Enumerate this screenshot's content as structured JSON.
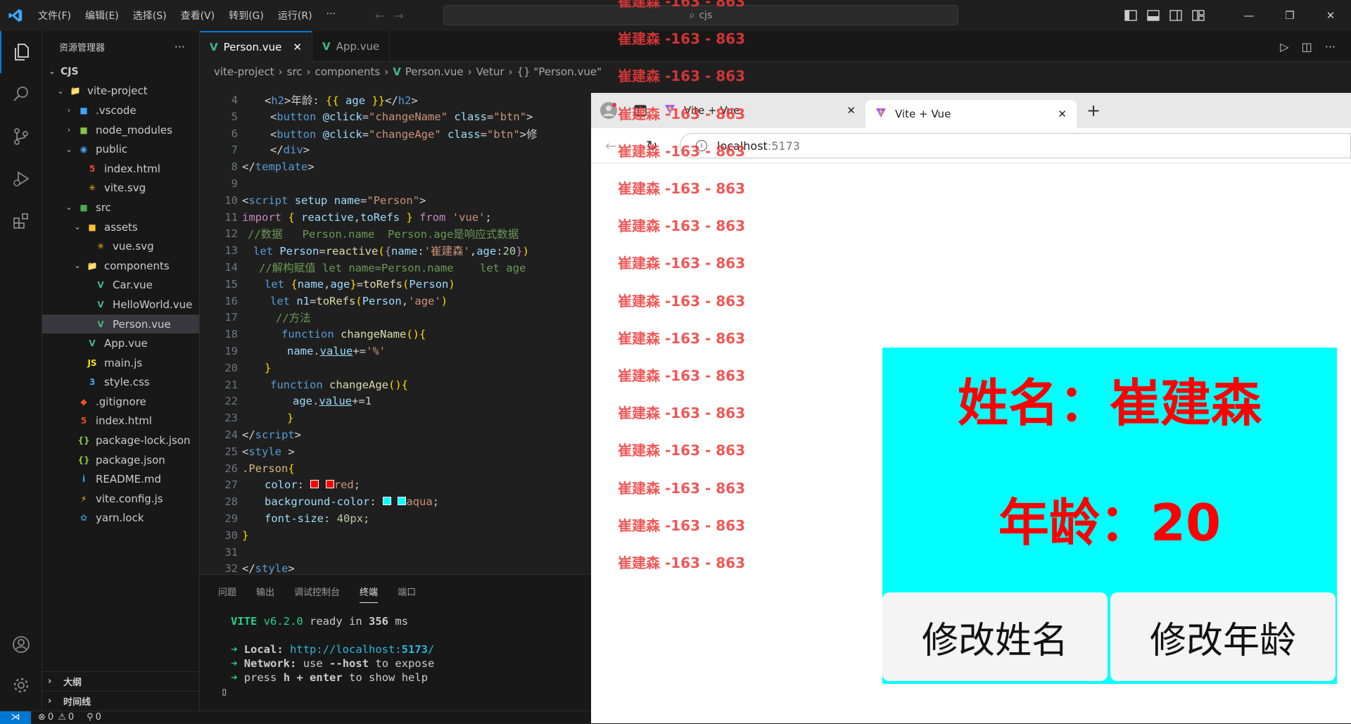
{
  "titlebar": {
    "menu": [
      "文件(F)",
      "编辑(E)",
      "选择(S)",
      "查看(V)",
      "转到(G)",
      "运行(R)",
      "···"
    ],
    "search": "cjs"
  },
  "explorer": {
    "title": "资源管理器",
    "more": "···",
    "root": "CJS",
    "tree": [
      {
        "label": "vite-project",
        "depth": 1,
        "chev": "v",
        "icon": "folder"
      },
      {
        "label": ".vscode",
        "depth": 2,
        "chev": ">",
        "icon": "vscode-folder"
      },
      {
        "label": "node_modules",
        "depth": 2,
        "chev": ">",
        "icon": "node-folder"
      },
      {
        "label": "public",
        "depth": 2,
        "chev": "v",
        "icon": "public-folder"
      },
      {
        "label": "index.html",
        "depth": 3,
        "chev": "",
        "icon": "html"
      },
      {
        "label": "vite.svg",
        "depth": 3,
        "chev": "",
        "icon": "svg"
      },
      {
        "label": "src",
        "depth": 2,
        "chev": "v",
        "icon": "src-folder"
      },
      {
        "label": "assets",
        "depth": 3,
        "chev": "v",
        "icon": "assets-folder"
      },
      {
        "label": "vue.svg",
        "depth": 4,
        "chev": "",
        "icon": "svg"
      },
      {
        "label": "components",
        "depth": 3,
        "chev": "v",
        "icon": "folder"
      },
      {
        "label": "Car.vue",
        "depth": 4,
        "chev": "",
        "icon": "vue"
      },
      {
        "label": "HelloWorld.vue",
        "depth": 4,
        "chev": "",
        "icon": "vue"
      },
      {
        "label": "Person.vue",
        "depth": 4,
        "chev": "",
        "icon": "vue",
        "selected": true
      },
      {
        "label": "App.vue",
        "depth": 3,
        "chev": "",
        "icon": "vue"
      },
      {
        "label": "main.js",
        "depth": 3,
        "chev": "",
        "icon": "js"
      },
      {
        "label": "style.css",
        "depth": 3,
        "chev": "",
        "icon": "css"
      },
      {
        "label": ".gitignore",
        "depth": 2,
        "chev": "",
        "icon": "git"
      },
      {
        "label": "index.html",
        "depth": 2,
        "chev": "",
        "icon": "html"
      },
      {
        "label": "package-lock.json",
        "depth": 2,
        "chev": "",
        "icon": "json"
      },
      {
        "label": "package.json",
        "depth": 2,
        "chev": "",
        "icon": "json"
      },
      {
        "label": "README.md",
        "depth": 2,
        "chev": "",
        "icon": "info"
      },
      {
        "label": "vite.config.js",
        "depth": 2,
        "chev": "",
        "icon": "vite"
      },
      {
        "label": "yarn.lock",
        "depth": 2,
        "chev": "",
        "icon": "yarn"
      }
    ],
    "outline": "大纲",
    "timeline": "时间线"
  },
  "tabs": [
    {
      "label": "Person.vue",
      "active": true
    },
    {
      "label": "App.vue",
      "active": false
    }
  ],
  "breadcrumb": [
    "vite-project",
    "src",
    "components",
    "Person.vue",
    "Vetur",
    "{} \"Person.vue\""
  ],
  "code": [
    {
      "n": "4",
      "html": "<span class='pu'>&lt;</span><span class='tg'>h2</span><span class='pu'>&gt;</span>年龄: <span class='br'>{{</span> <span class='at'>age</span> <span class='br'>}}</span><span class='pu'>&lt;/</span><span class='tg'>h2</span><span class='pu'>&gt;</span>",
      "indent": 92
    },
    {
      "n": "5",
      "html": "<span class='pu'>&lt;</span><span class='tg'>button</span> <span class='at'>@click</span>=<span class='st'>\"changeName\"</span> <span class='at'>class</span>=<span class='st'>\"btn\"</span><span class='pu'>&gt;</span>",
      "indent": 100
    },
    {
      "n": "6",
      "html": "<span class='pu'>&lt;</span><span class='tg'>button</span> <span class='at'>@click</span>=<span class='st'>\"changeAge\"</span> <span class='at'>class</span>=<span class='st'>\"btn\"</span><span class='pu'>&gt;</span>修",
      "indent": 100
    },
    {
      "n": "7",
      "html": "<span class='pu'>&lt;/</span><span class='tg'>div</span><span class='pu'>&gt;</span>",
      "indent": 100
    },
    {
      "n": "8",
      "html": "<span class='pu'>&lt;/</span><span class='tg'>template</span><span class='pu'>&gt;</span>",
      "indent": 60
    },
    {
      "n": "9",
      "html": "",
      "indent": 60
    },
    {
      "n": "10",
      "html": "<span class='pu'>&lt;</span><span class='tg'>script</span> <span class='at'>setup</span> <span class='at'>name</span>=<span class='st'>\"Person\"</span><span class='pu'>&gt;</span>",
      "indent": 60
    },
    {
      "n": "11",
      "html": "<span class='pk'>import</span> <span class='br'>{</span> <span class='at'>reactive</span>,<span class='at'>toRefs</span> <span class='br'>}</span> <span class='pk'>from</span> <span class='st'>'vue'</span>;",
      "indent": 60
    },
    {
      "n": "12",
      "html": "<span class='cm'>//数据   Person.name  Person.age是响应式数据</span>",
      "indent": 68
    },
    {
      "n": "13",
      "html": "<span class='kw'>let</span> <span class='at'>Person</span>=<span class='fn'>reactive</span><span class='br'>(</span><span class='pk'>{</span><span class='at'>name</span>:<span class='st'>'崔建森'</span>,<span class='at'>age</span>:<span class='num'>20</span><span class='pk'>}</span><span class='br'>)</span>",
      "indent": 76
    },
    {
      "n": "14",
      "html": "<span class='cm'>//解构赋值 let name=Person.name    let age</span>",
      "indent": 84
    },
    {
      "n": "15",
      "html": "<span class='kw'>let</span> <span class='br'>{</span><span class='at'>name</span>,<span class='at'>age</span><span class='br'>}</span>=<span class='fn'>toRefs</span><span class='br'>(</span><span class='at'>Person</span><span class='br'>)</span>",
      "indent": 92
    },
    {
      "n": "16",
      "html": "<span class='kw'>let</span> <span class='at'>n1</span>=<span class='fn'>toRefs</span><span class='br'>(</span><span class='at'>Person</span>,<span class='st'>'age'</span><span class='br'>)</span>",
      "indent": 100
    },
    {
      "n": "17",
      "html": "<span class='cm'>//方法</span>",
      "indent": 108
    },
    {
      "n": "18",
      "html": "<span class='kw'>function</span> <span class='fn'>changeName</span><span class='br'>()</span><span class='br'>{</span>",
      "indent": 116
    },
    {
      "n": "19",
      "html": "<span class='at'>name</span>.<span class='at' style='text-decoration:underline'>value</span>+=<span class='st'>'%'</span>",
      "indent": 124
    },
    {
      "n": "20",
      "html": "<span class='br'>}</span>",
      "indent": 92
    },
    {
      "n": "21",
      "html": "<span class='kw'>function</span> <span class='fn'>changeAge</span><span class='br'>()</span><span class='br'>{</span>",
      "indent": 100
    },
    {
      "n": "22",
      "html": "<span class='at'>age</span>.<span class='at' style='text-decoration:underline'>value</span>+=<span class='num'>1</span>",
      "indent": 132
    },
    {
      "n": "23",
      "html": "<span class='br'>}</span>",
      "indent": 124
    },
    {
      "n": "24",
      "html": "<span class='pu'>&lt;/</span><span class='tg'>script</span><span class='pu'>&gt;</span>",
      "indent": 60
    },
    {
      "n": "25",
      "html": "<span class='pu'>&lt;</span><span class='tg'>style</span> <span class='pu'>&gt;</span>",
      "indent": 60
    },
    {
      "n": "26",
      "html": "<span class='sel'>.Person</span><span class='br'>{</span>",
      "indent": 60
    },
    {
      "n": "27",
      "html": "<span class='at'>color</span>: <span style='display:inline-block;width:12px;height:12px;background:#ff0000;border:1px solid #fff'></span> <span style='display:inline-block;width:12px;height:12px;background:#ff0000;border:1px solid #fff'></span><span class='st'>red</span>;",
      "indent": 92
    },
    {
      "n": "28",
      "html": "<span class='at'>background-color</span>: <span style='display:inline-block;width:12px;height:12px;background:#00ffff;border:1px solid #fff'></span> <span style='display:inline-block;width:12px;height:12px;background:#00ffff;border:1px solid #fff'></span><span class='st'>aqua</span>;",
      "indent": 92
    },
    {
      "n": "29",
      "html": "<span class='at'>font-size</span>: <span class='num'>40px</span>;",
      "indent": 92
    },
    {
      "n": "30",
      "html": "<span class='br'>}</span>",
      "indent": 60
    },
    {
      "n": "31",
      "html": "",
      "indent": 60
    },
    {
      "n": "32",
      "html": "<span class='pu'>&lt;/</span><span class='tg'>style</span><span class='pu'>&gt;</span>",
      "indent": 60
    }
  ],
  "panel": {
    "tabs": [
      "问题",
      "输出",
      "调试控制台",
      "终端",
      "端口"
    ],
    "active_tab": "终端",
    "vite_name": "VITE",
    "vite_version": "v6.2.0",
    "ready_text": "ready in",
    "ready_ms": "356",
    "ms": "ms",
    "local_label": "Local:",
    "local_url_a": "http://localhost:",
    "local_url_b": "5173",
    "network_label": "Network:",
    "network_a": "use",
    "network_b": "--host",
    "network_c": "to expose",
    "help_a": "press",
    "help_b": "h + enter",
    "help_c": "to show help",
    "arrow": "➜",
    "cursor": "▯"
  },
  "status": {
    "errors": "0",
    "warnings": "0",
    "ports": "0"
  },
  "browser": {
    "tabs": [
      {
        "label": "Vite + Vue",
        "active": false
      },
      {
        "label": "Vite + Vue",
        "active": true
      }
    ],
    "url_host": "localhost",
    "url_port": ":5173",
    "person": {
      "name_label": "姓名：",
      "name_value": "崔建森",
      "age_label": "年龄：",
      "age_value": "20",
      "btn_name": "修改姓名",
      "btn_age": "修改年龄"
    }
  },
  "overlay_text": "崔建森 -163 - 863"
}
